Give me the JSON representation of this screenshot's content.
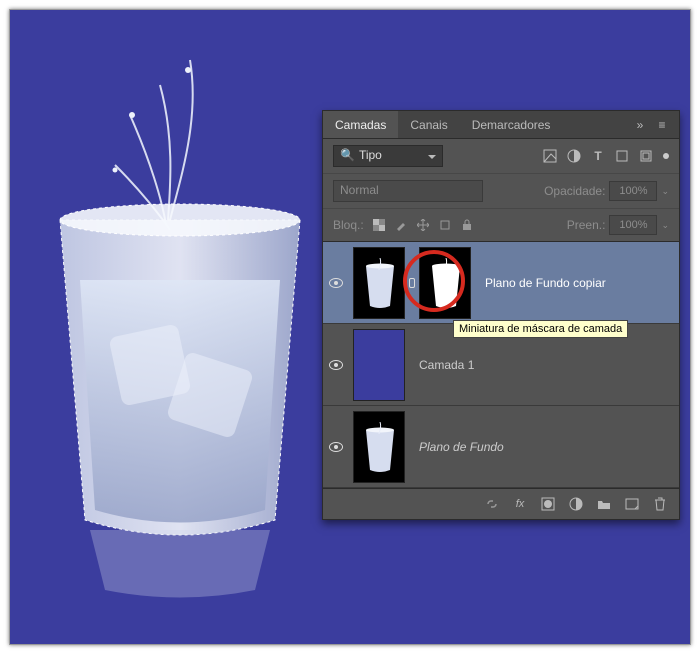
{
  "tabs": {
    "layers": "Camadas",
    "channels": "Canais",
    "paths": "Demarcadores"
  },
  "filter": {
    "label": "Tipo",
    "search_glyph": "🔍"
  },
  "blend": {
    "mode": "Normal",
    "opacity_label": "Opacidade:",
    "opacity_value": "100%"
  },
  "lock": {
    "label": "Bloq.:",
    "fill_label": "Preen.:",
    "fill_value": "100%"
  },
  "layers": [
    {
      "name": "Plano de Fundo copiar",
      "selected": true,
      "has_mask": true
    },
    {
      "name": "Camada 1",
      "selected": false,
      "has_mask": false
    },
    {
      "name": "Plano de Fundo",
      "selected": false,
      "has_mask": false,
      "bg": true
    }
  ],
  "tooltip": "Miniatura de máscara de camada",
  "footer_icons": [
    "link",
    "fx",
    "mask",
    "adjust",
    "group",
    "new",
    "trash"
  ]
}
